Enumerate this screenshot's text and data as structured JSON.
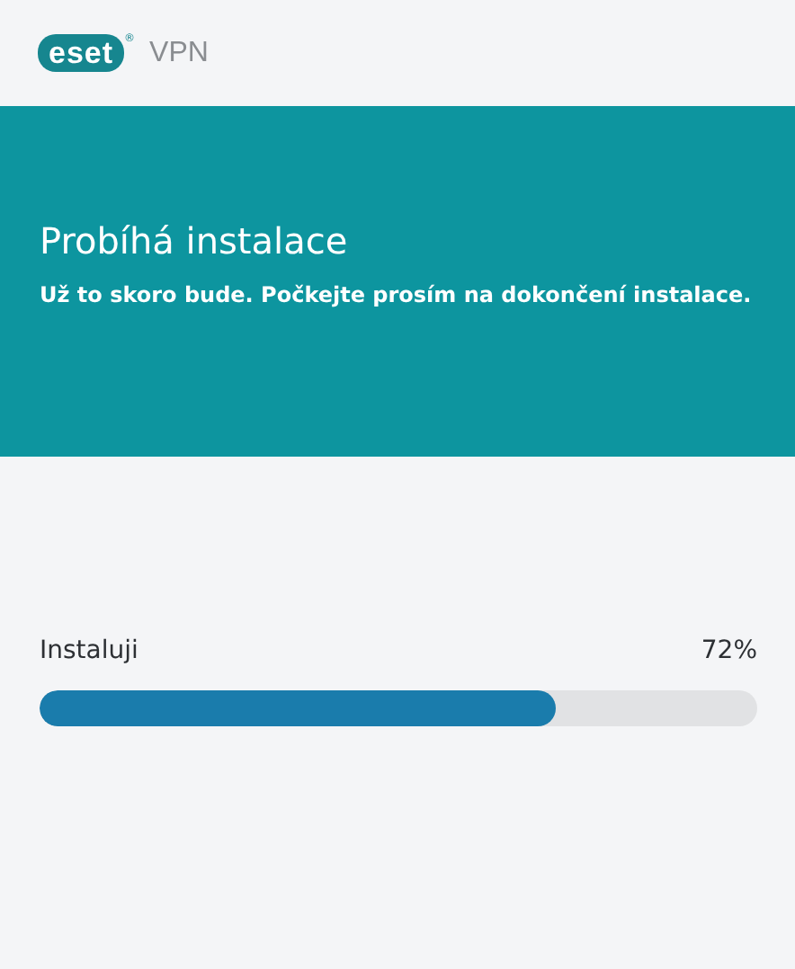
{
  "header": {
    "logo": "eset",
    "logo_mark": "®",
    "product": "VPN"
  },
  "banner": {
    "title": "Probíhá instalace",
    "subtitle": "Už to skoro bude. Počkejte prosím na dokončení instalace."
  },
  "progress": {
    "label": "Instaluji",
    "reading": "72%",
    "level": 0.72
  }
}
